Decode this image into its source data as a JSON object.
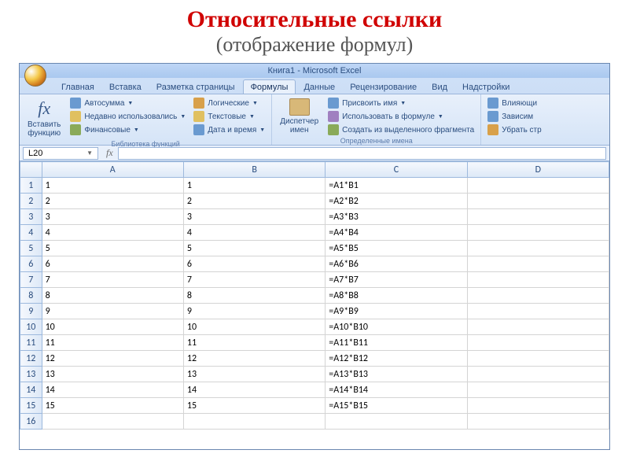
{
  "slide": {
    "title": "Относительные ссылки",
    "subtitle": "(отображение формул)"
  },
  "window": {
    "title": "Книга1  -  Microsoft Excel"
  },
  "tabs": {
    "home": "Главная",
    "insert": "Вставка",
    "layout": "Разметка страницы",
    "formulas": "Формулы",
    "data": "Данные",
    "review": "Рецензирование",
    "view": "Вид",
    "addins": "Надстройки"
  },
  "ribbon": {
    "insert_fn": "Вставить\nфункцию",
    "autosum": "Автосумма",
    "recent": "Недавно использовались",
    "financial": "Финансовые",
    "logical": "Логические",
    "text": "Текстовые",
    "datetime": "Дата и время",
    "name_mgr": "Диспетчер\nимен",
    "define_name": "Присвоить имя",
    "use_formula": "Использовать в формуле",
    "from_selection": "Создать из выделенного фрагмента",
    "trace_prec": "Влияющи",
    "trace_dep": "Зависим",
    "remove_arrows": "Убрать стр",
    "group1": "Библиотека функций",
    "group2": "Определенные имена"
  },
  "namebox": {
    "ref": "L20"
  },
  "columns": [
    "",
    "A",
    "B",
    "C",
    "D"
  ],
  "rows": [
    {
      "n": "1",
      "a": "1",
      "b": "1",
      "c": "=A1*B1",
      "d": ""
    },
    {
      "n": "2",
      "a": "2",
      "b": "2",
      "c": "=A2*B2",
      "d": ""
    },
    {
      "n": "3",
      "a": "3",
      "b": "3",
      "c": "=A3*B3",
      "d": ""
    },
    {
      "n": "4",
      "a": "4",
      "b": "4",
      "c": "=A4*B4",
      "d": ""
    },
    {
      "n": "5",
      "a": "5",
      "b": "5",
      "c": "=A5*B5",
      "d": ""
    },
    {
      "n": "6",
      "a": "6",
      "b": "6",
      "c": "=A6*B6",
      "d": ""
    },
    {
      "n": "7",
      "a": "7",
      "b": "7",
      "c": "=A7*B7",
      "d": ""
    },
    {
      "n": "8",
      "a": "8",
      "b": "8",
      "c": "=A8*B8",
      "d": ""
    },
    {
      "n": "9",
      "a": "9",
      "b": "9",
      "c": "=A9*B9",
      "d": ""
    },
    {
      "n": "10",
      "a": "10",
      "b": "10",
      "c": "=A10*B10",
      "d": ""
    },
    {
      "n": "11",
      "a": "11",
      "b": "11",
      "c": "=A11*B11",
      "d": ""
    },
    {
      "n": "12",
      "a": "12",
      "b": "12",
      "c": "=A12*B12",
      "d": ""
    },
    {
      "n": "13",
      "a": "13",
      "b": "13",
      "c": "=A13*B13",
      "d": ""
    },
    {
      "n": "14",
      "a": "14",
      "b": "14",
      "c": "=A14*B14",
      "d": ""
    },
    {
      "n": "15",
      "a": "15",
      "b": "15",
      "c": "=A15*B15",
      "d": ""
    },
    {
      "n": "16",
      "a": "",
      "b": "",
      "c": "",
      "d": ""
    }
  ]
}
